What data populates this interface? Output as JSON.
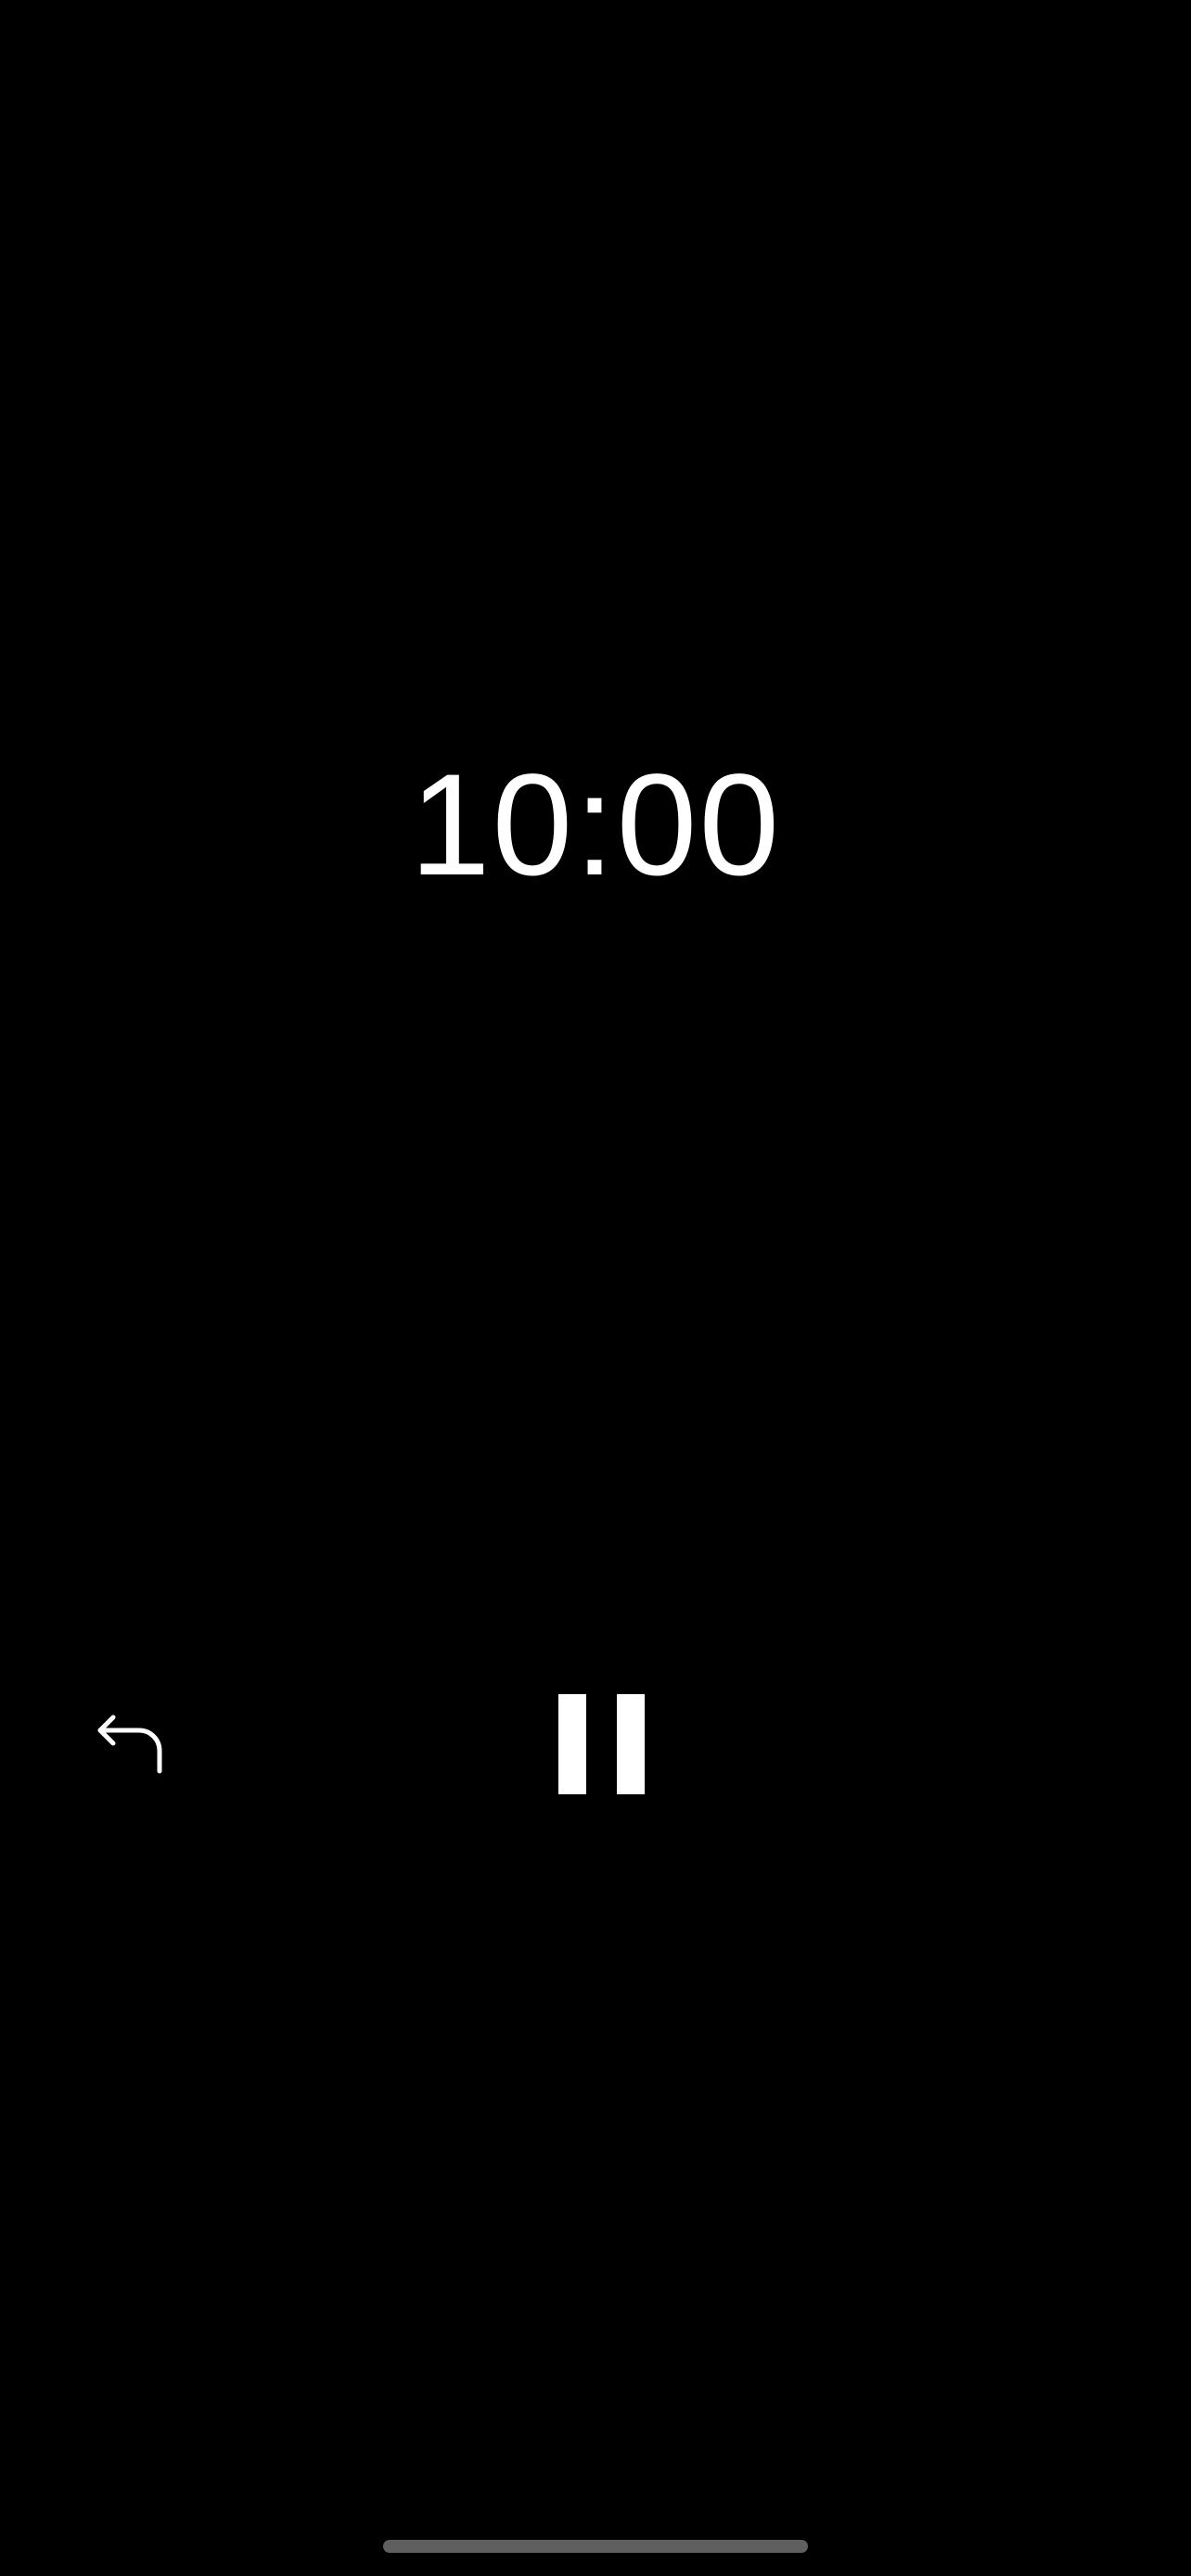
{
  "timer": {
    "display": "10:00"
  },
  "controls": {
    "reset_icon": "return-left-arrow-icon",
    "pause_icon": "pause-icon"
  },
  "colors": {
    "background": "#000000",
    "foreground": "#ffffff",
    "home_indicator": "#5f5f5f"
  }
}
